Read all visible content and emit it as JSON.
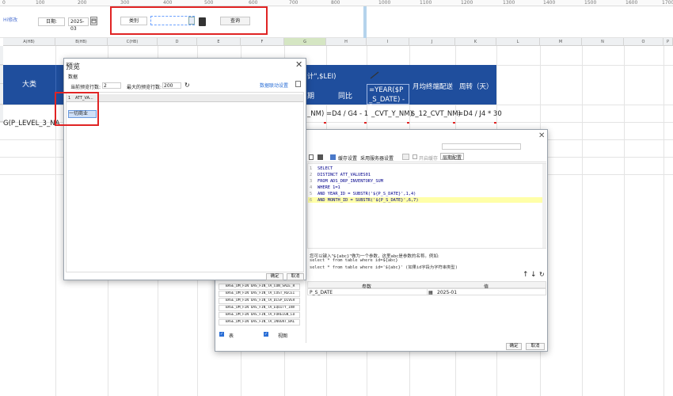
{
  "ruler": {
    "ticks": [
      {
        "label": "0"
      },
      {
        "label": "100"
      },
      {
        "label": "200"
      },
      {
        "label": "300"
      },
      {
        "label": "400"
      },
      {
        "label": "500"
      },
      {
        "label": "600"
      },
      {
        "label": "700"
      },
      {
        "label": "800"
      },
      {
        "label": "1000"
      },
      {
        "label": "1100"
      },
      {
        "label": "1200"
      },
      {
        "label": "1300"
      },
      {
        "label": "1400"
      },
      {
        "label": "1500"
      },
      {
        "label": "1600"
      },
      {
        "label": "1700"
      }
    ]
  },
  "param_bar": {
    "left_link": "Hi修改",
    "date_label": "日期:",
    "date_value": "2025-03",
    "category_label": "类别",
    "query_button": "查询"
  },
  "sheet": {
    "columns": [
      "A(HB)",
      "B(HB)",
      "C(HB)",
      "D",
      "E",
      "F",
      "G",
      "H",
      "I",
      "J",
      "K",
      "L",
      "M",
      "N",
      "O",
      "P"
    ],
    "header_cell_a": "大类",
    "formula_fragment_top": "计\",$LEI)",
    "header_i_lines": [
      "=YEAR($P",
      "_S_DATE) - 1"
    ],
    "header_h": "同比",
    "header_j": "月均终端配送",
    "header_k": "周转（天）",
    "row3": {
      "a_text": "G(P_LEVEL_3_NA",
      "formula_g": "_NM)",
      "formula_h": "=D4 / G4 - 1",
      "formula_i": "_CVT_Y_NM)",
      "formula_j": "$_12_CVT_NM)",
      "formula_k": "=D4 / J4 * 30"
    }
  },
  "preview_dialog": {
    "title": "预览",
    "section": "数据",
    "current_rows_label": "当前预览行数:",
    "current_rows_value": "2",
    "max_rows_label": "最大的预览行数:",
    "max_rows_value": "200",
    "settings_link": "数据联动设置",
    "column_header_index": "1",
    "column_header_name": "ATT_VA...",
    "cell_value": "一切商业",
    "ok_button": "确定",
    "cancel_button": "取消",
    "accent_color": "#e02424"
  },
  "sql_dialog": {
    "toolbar": {
      "cache_label": "缓存设置",
      "server_label": "采用服务器设置",
      "open_cache": "开启缓存",
      "paging_label": "层期配置"
    },
    "sql_lines": [
      {
        "n": "1",
        "text": "SELECT"
      },
      {
        "n": "2",
        "text": "DISTINCT ATT_VALUES01"
      },
      {
        "n": "3",
        "text": "FROM ADS_DRP_INVENTORY_SUM"
      },
      {
        "n": "4",
        "text": "WHERE 1=1"
      },
      {
        "n": "5",
        "text": "AND YEAR_ID = SUBSTR('${P_S_DATE}',1,4)"
      },
      {
        "n": "6",
        "text": "AND MONTH_ID = SUBSTR('${P_S_DATE}',6,7)"
      }
    ],
    "hint_lines": [
      "您可以键入\"${abc}\"做为一个参数，这里abc是参数的名称。例如:",
      "select * from table where id=${abc}",
      "select * from table where id='${abc}' (如果id字段为字符串类型)"
    ],
    "param_header": "参数",
    "value_header": "值",
    "param_name": "P_S_DATE",
    "param_value": "2025-01",
    "table_rows": [
      "BASE_DM_FIN OAS_FIN_TA_CON_SALE_R",
      "BASE_DM_FIN OAS_FIN_TA_COST_RECEI",
      "BASE_DM_FIN OAS_FIN_TA_DISP_DIVER",
      "BASE_DM_FIN OAS_FIN_TA_EQUITY_INV",
      "BASE_DM_FIN OAS_FIN_TA_FOREIGN_LO",
      "BASE_DM_FIN OAS_FIN_TA_INVENT_BAL"
    ],
    "table_checkbox_label": "表",
    "view_checkbox_label": "视图",
    "ok_button": "确定",
    "cancel_button": "取消"
  },
  "colors": {
    "header_blue": "#1f4e9d",
    "highlight_line": "#ffffa8",
    "sql_keyword": "#00008b",
    "sql_string": "#c2185b"
  }
}
